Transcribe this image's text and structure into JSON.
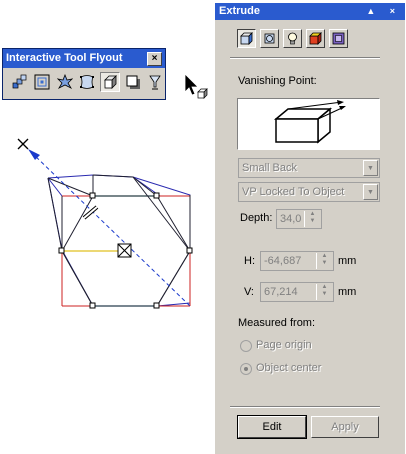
{
  "flyout": {
    "title": "Interactive Tool Flyout",
    "close_glyph": "×",
    "tools": [
      {
        "name": "blend-tool-icon"
      },
      {
        "name": "contour-tool-icon"
      },
      {
        "name": "distortion-tool-icon"
      },
      {
        "name": "envelope-tool-icon"
      },
      {
        "name": "extrude-tool-icon",
        "active": true
      },
      {
        "name": "drop-shadow-tool-icon"
      },
      {
        "name": "transparency-tool-icon"
      }
    ]
  },
  "docker": {
    "title": "Extrude",
    "title_buttons": "▲ ×",
    "vanishing_point_label": "Vanishing Point:",
    "extrusion_type": "Small Back",
    "vp_mode": "VP Locked To Object",
    "depth_label": "Depth:",
    "depth_value": "34,0",
    "h_label": "H:",
    "h_value": "-64,687",
    "h_unit": "mm",
    "v_label": "V:",
    "v_value": "67,214",
    "v_unit": "mm",
    "measured_from_label": "Measured from:",
    "page_origin_label": "Page origin",
    "object_center_label": "Object center",
    "edit_button": "Edit",
    "apply_button": "Apply"
  },
  "colors": {
    "title_bar": "#2a5bcf",
    "face": "#d4d0c8",
    "extrude_front": "#cc2222",
    "extrude_back": "#2a2ab0",
    "vanishing_point": "#1a3acc"
  }
}
